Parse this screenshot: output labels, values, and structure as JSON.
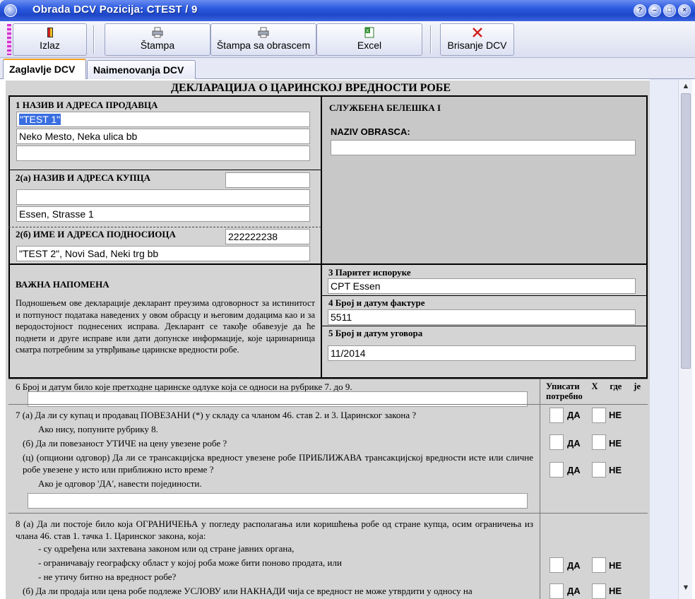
{
  "window": {
    "title": "Obrada DCV   Pozicija: CTEST / 9"
  },
  "toolbar": {
    "izlaz": "Izlaz",
    "stampa": "Štampa",
    "stampa_obrazac": "Štampa sa obrascem",
    "excel": "Excel",
    "brisanje": "Brisanje DCV"
  },
  "tabs": {
    "zaglavlje": "Zaglavlje DCV",
    "naimenovanja": "Naimenovanja DCV"
  },
  "form": {
    "heading": "ДЕКЛАРАЦИЈА О ЦАРИНСКОЈ ВРЕДНОСТИ РОБЕ",
    "s1_label": "1  НАЗИВ И АДРЕСА ПРОДАВЦА",
    "s1_line1": "\"TEST 1\"",
    "s1_line2": "Neko Mesto, Neka ulica bb",
    "s1_line3": "",
    "note_title": "СЛУЖБЕНА БЕЛЕШКА I",
    "naziv_obrasca_label": "NAZIV OBRASCA:",
    "naziv_obrasca": "",
    "s2a_label": "2(a)  НАЗИВ И АДРЕСА КУПЦА",
    "s2a_code": "",
    "s2a_line1": "",
    "s2a_line2": "Essen, Strasse 1",
    "s2b_label": "2(б)  ИМЕ И АДРЕСА ПОДНОСИОЦА",
    "s2b_code": "222222238",
    "s2b_line1": "\"TEST 2\", Novi Sad, Neki trg bb",
    "important_title": "ВАЖНА НАПОМЕНА",
    "important_text": "Подношењем ове декларације декларант преузима одговорност за истинитост и потпуност података наведених у овом обрасцу и његовим додацима као и за веродостојност поднесених исправа. Декларант се такође обавезује да ће поднети и друге исправе или дати допунске информације, које царинарница сматра потребним за утврђивање царинске вредности робе.",
    "s3_label": "3  Паритет испоруке",
    "s3_value": "CPT Essen",
    "s4_label": "4  Број и датум фактуре",
    "s4_value": "5511",
    "s5_label": "5  Број и датум уговора",
    "s5_value": "11/2014",
    "s6_label": "6  Број и датум било које претходне царинске одлуке која се односи на рубрике 7. до 9.",
    "s6_value": "",
    "upisati_header": "Уписати  X  где  је потребно",
    "s7a": "7 (а) Да ли су купац и продавац ПОВЕЗАНИ (*) у складу са чланом 46.  став 2. и 3. Царинског закона ?",
    "s7a_sub": "Ако нису, попуните рубрику 8.",
    "s7b": "(б) Да ли повезаност УТИЧЕ на цену увезене робе ?",
    "s7c": "(ц) (опциони одговор) Да ли се трансакцијска вредност увезене робе ПРИБЛИЖАВА трансакцијској вредности исте или сличне робе увезене у исто или приближно исто време ?",
    "s7c_sub": "Ако је одговор 'ДА', навести појединости.",
    "s7_value": "",
    "s8a": "8 (а) Да ли постоје било која ОГРАНИЧЕЊА у погледу располагања или коришћења робе од стране купца, осим ограничења из члана 46. став 1. тачка 1. Царинског закона, која:",
    "s8a_1": "- су одређена или захтевана законом или од стране јавних органа,",
    "s8a_2": "- ограничавају  географску област у којој роба може бити поново продата, или",
    "s8a_3": "- не утичу битно на вредност робе?",
    "s8b": "(б) Да ли продаја или цена робе подлеже УСЛОВУ или НАКНАДИ чија се вредност не може утврдити у односу на",
    "da": "ДА",
    "ne": "НЕ"
  }
}
